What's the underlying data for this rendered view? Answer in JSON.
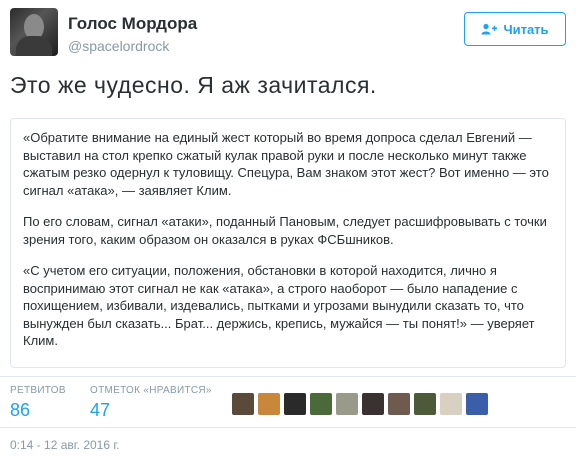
{
  "user": {
    "display_name": "Голос Мордора",
    "handle": "@spacelordrock"
  },
  "follow_button": {
    "label": "Читать",
    "icon": "add-user-icon",
    "color": "#1da1f2"
  },
  "tweet": {
    "text": "Это же чудесно. Я аж зачитался."
  },
  "quote": {
    "paragraphs": [
      "«Обратите внимание на единый жест который во время допроса сделал Евгений — выставил на стол крепко сжатый кулак правой руки и после несколько минут также сжатым резко одернул к туловищу. Спецура, Вам знаком этот жест? Вот именно — это сигнал «атака», — заявляет Клим.",
      "По его словам, сигнал «атаки», поданный Пановым, следует расшифровывать с точки зрения того, каким образом он оказался в руках ФСБшников.",
      "«С учетом его ситуации, положения, обстановки в которой находится, лично я воспринимаю этот сигнал не как «атака», а строго наоборот — было нападение с похищением, избивали, издевались, пытками и угрозами вынудили сказать то, что вынужден был сказать... Брат... держись, крепись, мужайся — ты понят!» — уверяет Клим."
    ]
  },
  "stats": {
    "retweets_label": "РЕТВИТОВ",
    "retweets_value": "86",
    "likes_label": "ОТМЕТОК «НРАВИТСЯ»",
    "likes_value": "47"
  },
  "liker_avatars": [
    {
      "name": "liker-avatar-1",
      "color": "#5a4a3a"
    },
    {
      "name": "liker-avatar-2",
      "color": "#c8873a"
    },
    {
      "name": "liker-avatar-3",
      "color": "#2a2a2a"
    },
    {
      "name": "liker-avatar-4",
      "color": "#4b6a3a"
    },
    {
      "name": "liker-avatar-5",
      "color": "#9a9a8a"
    },
    {
      "name": "liker-avatar-6",
      "color": "#3a3230"
    },
    {
      "name": "liker-avatar-7",
      "color": "#6e5a4e"
    },
    {
      "name": "liker-avatar-8",
      "color": "#4d5a3a"
    },
    {
      "name": "liker-avatar-9",
      "color": "#d8d0c0"
    },
    {
      "name": "liker-avatar-10",
      "color": "#3b5ea8"
    }
  ],
  "timestamp": "0:14 - 12 авг. 2016 г."
}
